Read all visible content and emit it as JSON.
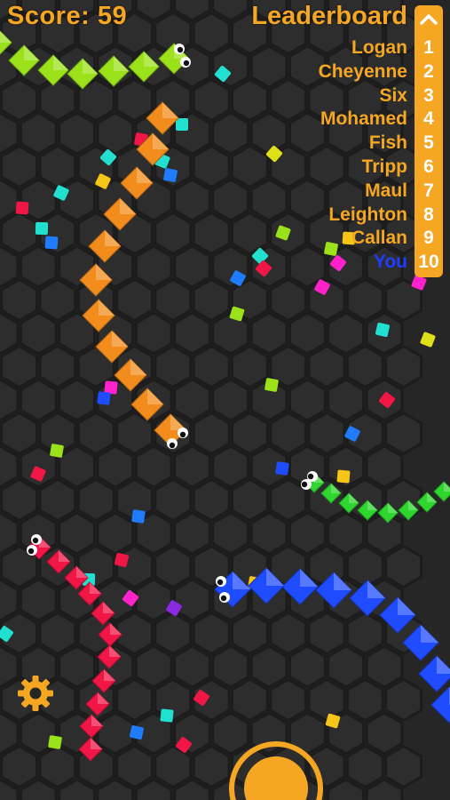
{
  "hud": {
    "score_label": "Score: 59"
  },
  "leaderboard": {
    "title": "Leaderboard",
    "entries": [
      {
        "rank": "1",
        "name": "Logan"
      },
      {
        "rank": "2",
        "name": "Cheyenne"
      },
      {
        "rank": "3",
        "name": "Six"
      },
      {
        "rank": "4",
        "name": "Mohamed"
      },
      {
        "rank": "5",
        "name": "Fish"
      },
      {
        "rank": "6",
        "name": "Tripp"
      },
      {
        "rank": "7",
        "name": "Maul"
      },
      {
        "rank": "8",
        "name": "Leighton"
      },
      {
        "rank": "9",
        "name": "Callan"
      },
      {
        "rank": "10",
        "name": "You"
      }
    ]
  },
  "colors": {
    "background": "#262626",
    "hex_fill": "#2d2d2d",
    "hex_line": "#1c1c1c",
    "accent": "#f5a623",
    "you_color": "#1f3cff",
    "lime_snake": "#9be21a",
    "orange_snake": "#f28c1c",
    "green_snake": "#2ed62e",
    "blue_snake": "#1f4cff",
    "red_snake": "#f01646"
  },
  "icons": {
    "settings": "gear-icon",
    "boost": "boost-button",
    "leaderboard_toggle": "chevron-up-icon"
  }
}
